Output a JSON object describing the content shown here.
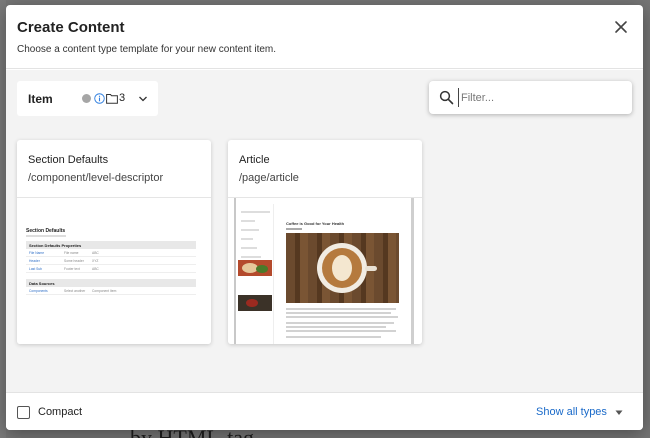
{
  "background": {
    "bottom_text": "by HTML-tag"
  },
  "dialog": {
    "title": "Create Content",
    "subtitle": "Choose a content type template for your new content item.",
    "close_icon": "close-icon"
  },
  "toolbar": {
    "item_label": "Item",
    "item_count": "3",
    "filter_placeholder": "Filter..."
  },
  "cards": [
    {
      "name": "Section Defaults",
      "path": "/component/level-descriptor",
      "preview": {
        "title": "Section Defaults",
        "section_header": "Section Defaults Properties",
        "rows": [
          [
            "File Name",
            "File name",
            "ABC"
          ],
          [
            "Header",
            "Some header",
            "XYZ"
          ],
          [
            "Last Sub",
            "Footer text",
            "ABC"
          ]
        ],
        "section2_header": "Data Sources",
        "rows2": [
          [
            "Components",
            "Select another",
            "Component Item"
          ]
        ]
      }
    },
    {
      "name": "Article",
      "path": "/page/article",
      "preview": {
        "title": "Coffee is Good for Your Health"
      }
    }
  ],
  "footer": {
    "compact_label": "Compact",
    "compact_checked": false,
    "show_types_label": "Show all types"
  },
  "colors": {
    "link": "#1a6ac9",
    "muted_dot": "#a6a6a6",
    "info_blue": "#2f7fe0"
  }
}
